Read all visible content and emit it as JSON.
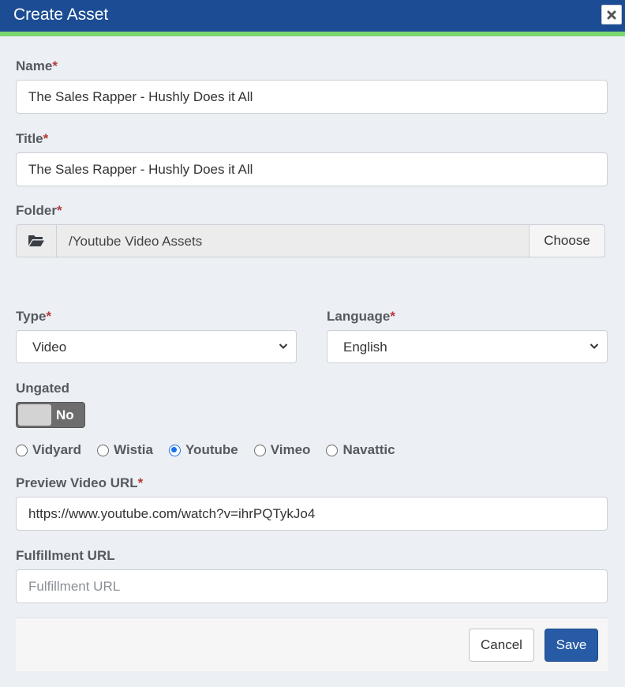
{
  "dialog": {
    "title": "Create Asset",
    "close_icon": "close-icon"
  },
  "form": {
    "name": {
      "label": "Name",
      "required_mark": "*",
      "value": "The Sales Rapper - Hushly Does it All"
    },
    "title": {
      "label": "Title",
      "required_mark": "*",
      "value": "The Sales Rapper - Hushly Does it All"
    },
    "folder": {
      "label": "Folder",
      "required_mark": "*",
      "icon": "folder-open-icon",
      "path": "/Youtube Video Assets",
      "choose_label": "Choose"
    },
    "type": {
      "label": "Type",
      "required_mark": "*",
      "selected": "Video"
    },
    "language": {
      "label": "Language",
      "required_mark": "*",
      "selected": "English"
    },
    "ungated": {
      "label": "Ungated",
      "toggle_state": "No"
    },
    "video_providers": [
      {
        "label": "Vidyard",
        "checked": false
      },
      {
        "label": "Wistia",
        "checked": false
      },
      {
        "label": "Youtube",
        "checked": true
      },
      {
        "label": "Vimeo",
        "checked": false
      },
      {
        "label": "Navattic",
        "checked": false
      }
    ],
    "preview_video_url": {
      "label": "Preview Video URL",
      "required_mark": "*",
      "value": "https://www.youtube.com/watch?v=ihrPQTykJo4"
    },
    "fulfillment_url": {
      "label": "Fulfillment URL",
      "value": "",
      "placeholder": "Fulfillment URL"
    }
  },
  "footer": {
    "cancel_label": "Cancel",
    "save_label": "Save"
  },
  "colors": {
    "header_bg": "#1c4d94",
    "header_stripe": "#7ad66f",
    "required": "#b53a3a",
    "primary_button": "#275ba6",
    "radio_checked": "#1a73e8"
  }
}
